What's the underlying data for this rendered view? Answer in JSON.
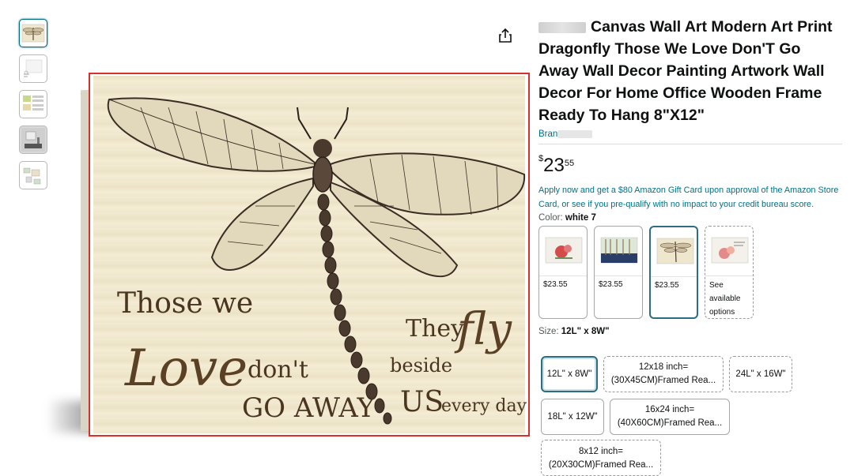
{
  "product": {
    "title_lines": [
      "Canvas Wall Art Modern Art Print",
      "Dragonfly Those We Love Don'T Go",
      "Away Wall Decor Painting Artwork Wall",
      "Decor For Home Office Wooden Frame",
      "Ready To Hang 8\"X12\""
    ],
    "brand_prefix": "Bran",
    "price_symbol": "$",
    "price_whole": "23",
    "price_fraction": "55",
    "promo": "Apply now and get a $80 Amazon Gift Card upon approval of the Amazon Store Card, or see if you pre-qualify with no impact to your credit bureau score."
  },
  "color": {
    "label": "Color:",
    "selected": "white 7",
    "options": [
      {
        "price": "$23.55",
        "icon": "flower-canvas-thumbnail"
      },
      {
        "price": "$23.55",
        "icon": "forest-canvas-thumbnail"
      },
      {
        "price": "$23.55",
        "icon": "dragonfly-canvas-thumbnail"
      },
      {
        "see_lines": [
          "See",
          "available",
          "options"
        ],
        "icon": "flower-canvas-thumbnail"
      }
    ]
  },
  "size": {
    "label": "Size:",
    "selected": "12L\" x 8W\"",
    "options": [
      {
        "label": "12L\" x 8W\""
      },
      {
        "lines": [
          "12x18 inch=",
          "(30X45CM)Framed Rea..."
        ]
      },
      {
        "label": "24L\" x 16W\""
      },
      {
        "label": "18L\" x 12W\""
      },
      {
        "lines": [
          "16x24 inch=",
          "(40X60CM)Framed Rea..."
        ]
      },
      {
        "lines": [
          "8x12 inch=",
          "(20X30CM)Framed Rea..."
        ]
      }
    ]
  },
  "artwork": {
    "text_left_1": "Those we",
    "text_love": "Love",
    "text_dont": "don't",
    "text_go_away": "GO AWAY",
    "text_they": "They",
    "text_fly": "fly",
    "text_beside": "beside",
    "text_us": "US",
    "text_every_day": "every day"
  },
  "icons": {
    "share": "share-icon"
  },
  "colors": {
    "link": "#007185",
    "selected_border": "#2c6d80",
    "image_highlight": "#d8312a"
  }
}
